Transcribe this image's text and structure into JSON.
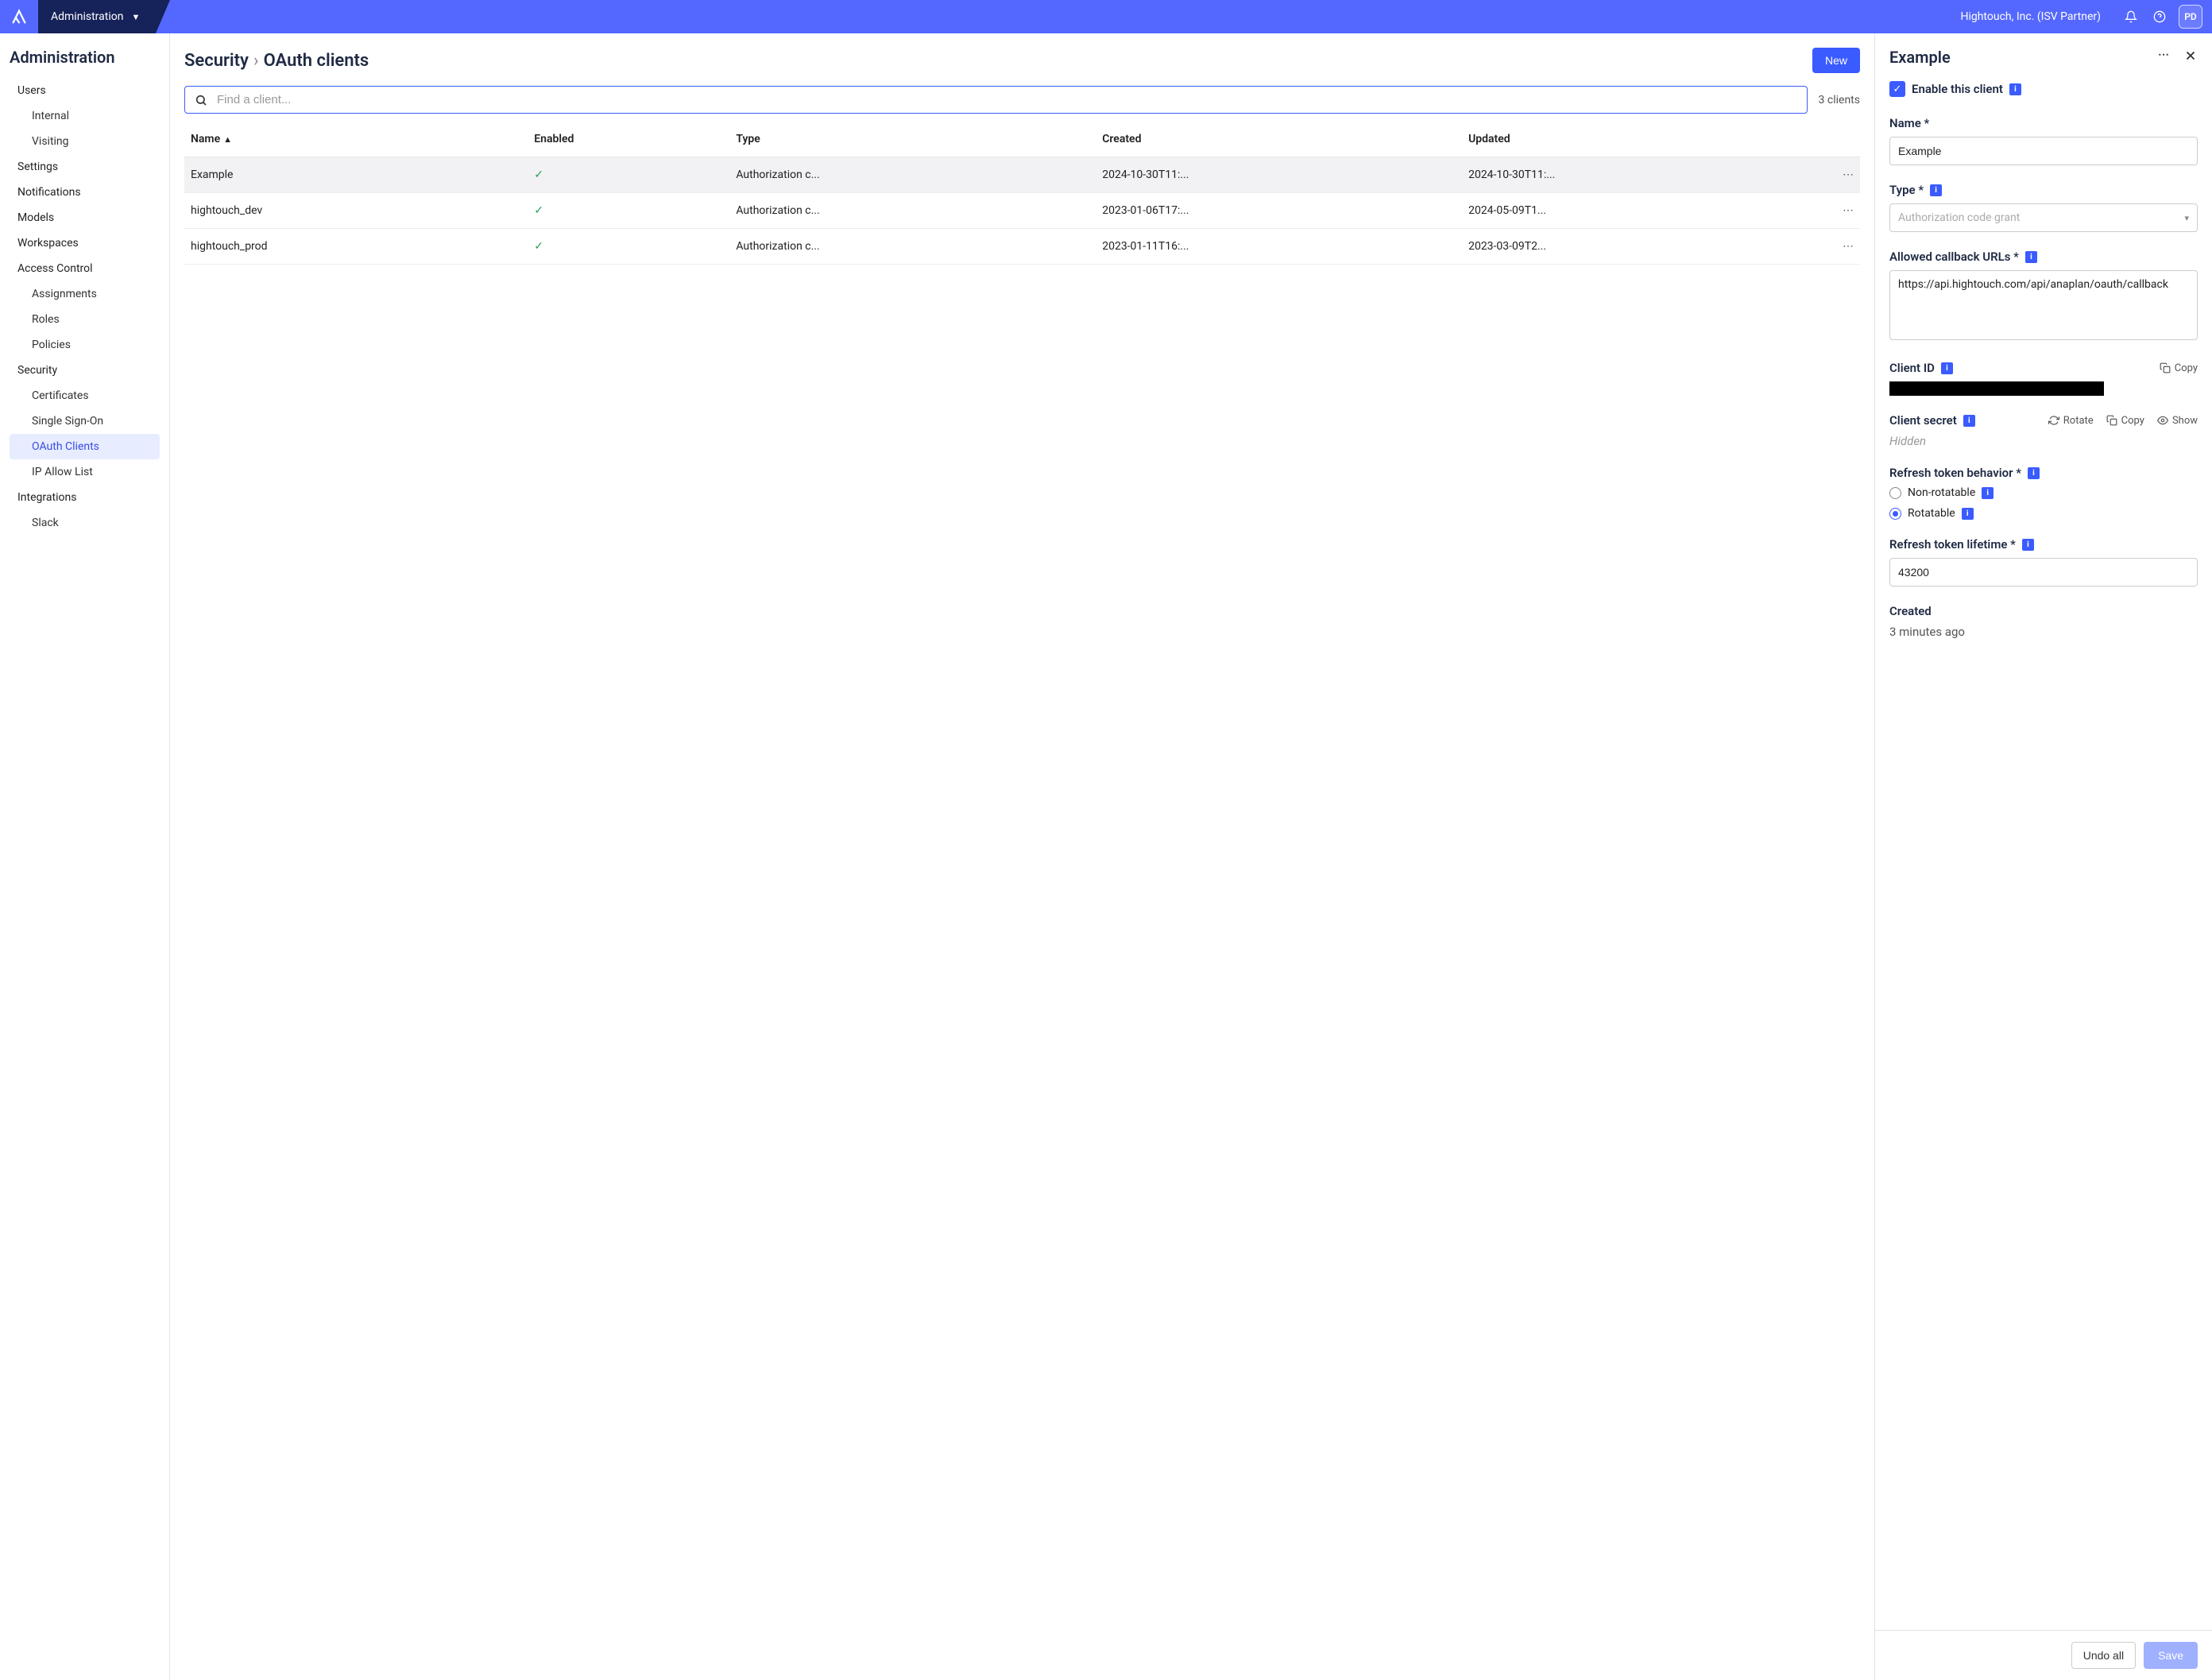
{
  "topbar": {
    "section": "Administration",
    "org": "Hightouch, Inc. (ISV Partner)",
    "avatar": "PD"
  },
  "sidebar": {
    "title": "Administration",
    "items": [
      {
        "label": "Users",
        "sub": false
      },
      {
        "label": "Internal",
        "sub": true
      },
      {
        "label": "Visiting",
        "sub": true
      },
      {
        "label": "Settings",
        "sub": false
      },
      {
        "label": "Notifications",
        "sub": false
      },
      {
        "label": "Models",
        "sub": false
      },
      {
        "label": "Workspaces",
        "sub": false
      },
      {
        "label": "Access Control",
        "sub": false
      },
      {
        "label": "Assignments",
        "sub": true
      },
      {
        "label": "Roles",
        "sub": true
      },
      {
        "label": "Policies",
        "sub": true
      },
      {
        "label": "Security",
        "sub": false
      },
      {
        "label": "Certificates",
        "sub": true
      },
      {
        "label": "Single Sign-On",
        "sub": true
      },
      {
        "label": "OAuth Clients",
        "sub": true,
        "active": true
      },
      {
        "label": "IP Allow List",
        "sub": true
      },
      {
        "label": "Integrations",
        "sub": false
      },
      {
        "label": "Slack",
        "sub": true
      }
    ]
  },
  "content": {
    "breadcrumb_parent": "Security",
    "breadcrumb_current": "OAuth clients",
    "new_button": "New",
    "search_placeholder": "Find a client...",
    "count": "3 clients",
    "columns": {
      "name": "Name",
      "enabled": "Enabled",
      "type": "Type",
      "created": "Created",
      "updated": "Updated"
    },
    "rows": [
      {
        "name": "Example",
        "enabled": true,
        "type": "Authorization c...",
        "created": "2024-10-30T11:...",
        "updated": "2024-10-30T11:...",
        "selected": true
      },
      {
        "name": "hightouch_dev",
        "enabled": true,
        "type": "Authorization c...",
        "created": "2023-01-06T17:...",
        "updated": "2024-05-09T1...",
        "selected": false
      },
      {
        "name": "hightouch_prod",
        "enabled": true,
        "type": "Authorization c...",
        "created": "2023-01-11T16:...",
        "updated": "2023-03-09T2...",
        "selected": false
      }
    ]
  },
  "detail": {
    "title": "Example",
    "enable_label": "Enable this client",
    "enable_checked": true,
    "name_label": "Name *",
    "name_value": "Example",
    "type_label": "Type *",
    "type_placeholder": "Authorization code grant",
    "callback_label": "Allowed callback URLs *",
    "callback_value": "https://api.hightouch.com/api/anaplan/oauth/callback",
    "client_id_label": "Client ID",
    "copy_label": "Copy",
    "client_secret_label": "Client secret",
    "rotate_label": "Rotate",
    "show_label": "Show",
    "hidden_text": "Hidden",
    "refresh_behavior_label": "Refresh token behavior *",
    "radio_nonrotatable": "Non-rotatable",
    "radio_rotatable": "Rotatable",
    "refresh_lifetime_label": "Refresh token lifetime *",
    "refresh_lifetime_value": "43200",
    "created_label": "Created",
    "created_value": "3 minutes ago",
    "undo_label": "Undo all",
    "save_label": "Save"
  }
}
